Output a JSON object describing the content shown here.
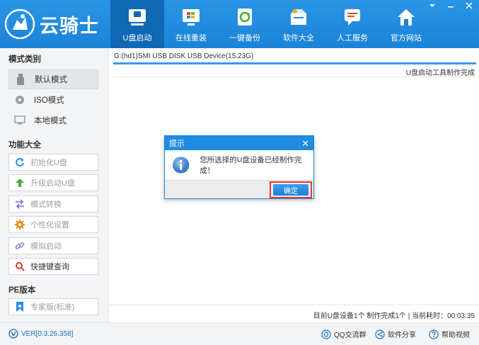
{
  "app": {
    "logo_text": "云骑士"
  },
  "nav": {
    "items": [
      {
        "label": "U盘启动",
        "icon": "usb-drive-icon",
        "active": true
      },
      {
        "label": "在线重装",
        "icon": "windows-monitor-icon"
      },
      {
        "label": "一键备份",
        "icon": "backup-icon"
      },
      {
        "label": "软件大全",
        "icon": "software-box-icon"
      },
      {
        "label": "人工服务",
        "icon": "chat-service-icon"
      },
      {
        "label": "官方网站",
        "icon": "home-icon"
      }
    ]
  },
  "sidebar": {
    "modes_title": "模式类别",
    "modes": [
      {
        "label": "默认模式",
        "icon": "usb-stick-icon",
        "active": true
      },
      {
        "label": "ISO模式",
        "icon": "disc-icon"
      },
      {
        "label": "本地模式",
        "icon": "monitor-icon"
      }
    ],
    "functions_title": "功能大全",
    "functions": [
      {
        "label": "初始化U盘",
        "icon": "refresh-icon",
        "enabled": false
      },
      {
        "label": "升级启动U盘",
        "icon": "upload-arrow-icon",
        "enabled": false
      },
      {
        "label": "模式转换",
        "icon": "convert-arrows-icon",
        "enabled": false
      },
      {
        "label": "个性化设置",
        "icon": "gear-icon",
        "enabled": false
      },
      {
        "label": "模拟启动",
        "icon": "link-icon",
        "enabled": false
      },
      {
        "label": "快捷键查询",
        "icon": "search-icon",
        "enabled": true
      }
    ],
    "pe_title": "PE版本",
    "pe_button": {
      "label": "专家版(标准)",
      "icon": "bookmark-icon"
    }
  },
  "main": {
    "device": "G:(hd1)SMI USB DISK USB Device(15.23G)",
    "progress": 1.0,
    "status": "U盘启动工具制作完成",
    "bottom_status": "目前U盘设备1个 制作完成1个 | 当前耗时：00:03:35"
  },
  "dialog": {
    "title": "提示",
    "message": "您所选择的U盘设备已经制作完成！",
    "ok_label": "确定"
  },
  "footer": {
    "version": "VER[0.3.26.358]",
    "links": [
      {
        "label": "QQ交流群",
        "icon": "qq-icon"
      },
      {
        "label": "软件分享",
        "icon": "share-icon"
      },
      {
        "label": "帮助视频",
        "icon": "help-icon"
      }
    ]
  },
  "colors": {
    "header": "#1a83d8",
    "active_nav": "#1168b5",
    "highlight": "#e23b3b"
  }
}
